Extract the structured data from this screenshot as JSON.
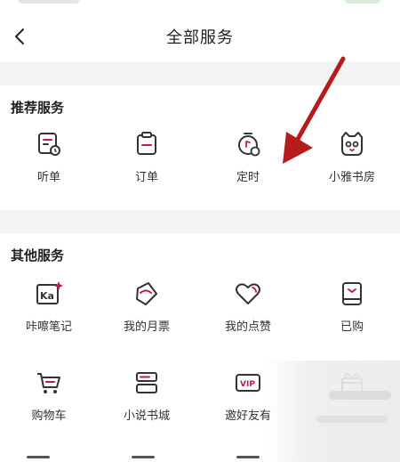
{
  "header": {
    "title": "全部服务"
  },
  "recommended": {
    "title": "推荐服务",
    "items": [
      {
        "label": "听单",
        "icon": "list-clock-icon"
      },
      {
        "label": "订单",
        "icon": "order-clipboard-icon"
      },
      {
        "label": "定时",
        "icon": "timer-icon"
      },
      {
        "label": "小雅书房",
        "icon": "cat-face-icon"
      }
    ]
  },
  "other": {
    "title": "其他服务",
    "items": [
      {
        "label": "咔嚓笔记",
        "icon": "ka-note-icon"
      },
      {
        "label": "我的月票",
        "icon": "ticket-icon"
      },
      {
        "label": "我的点赞",
        "icon": "heart-icon"
      },
      {
        "label": "已购",
        "icon": "purchased-box-icon"
      },
      {
        "label": "购物车",
        "icon": "cart-icon"
      },
      {
        "label": "小说书城",
        "icon": "books-icon"
      },
      {
        "label": "邀好友有",
        "icon": "vip-icon"
      },
      {
        "label": "",
        "icon": "gift-icon"
      }
    ]
  },
  "colors": {
    "accent": "#c2185b",
    "icon": "#333333",
    "annotation": "#b71c1c"
  }
}
